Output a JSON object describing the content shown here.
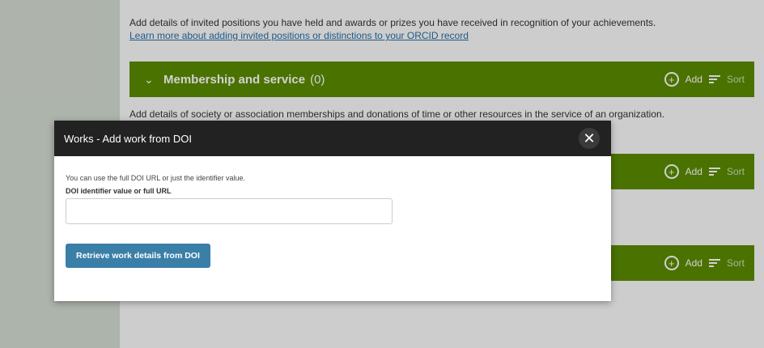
{
  "intro": {
    "text": "Add details of invited positions you have held and awards or prizes you have received in recognition of your achievements.",
    "link": "Learn more about adding invited positions or distinctions to your ORCID record"
  },
  "sections": [
    {
      "title": "Membership and service",
      "count": "(0)",
      "add": "Add",
      "sort": "Sort",
      "description": "Add details of society or association memberships and donations of time or other resources in the service of an organization."
    },
    {
      "add": "Add",
      "sort": "Sort"
    },
    {
      "add": "Add",
      "sort": "Sort"
    }
  ],
  "colors": {
    "section_bar": "#5b8c00",
    "modal_header": "#222222",
    "button": "#3a7fa8"
  },
  "icons": {
    "chevron": "chevron-down-icon",
    "add": "add-circle-icon",
    "sort": "sort-icon",
    "close": "close-icon"
  },
  "modal": {
    "title": "Works - Add work from DOI",
    "close": "✕",
    "hint": "You can use the full DOI URL or just the identifier value.",
    "field_label": "DOI identifier value or full URL",
    "input_value": "",
    "button_label": "Retrieve work details from DOI"
  }
}
